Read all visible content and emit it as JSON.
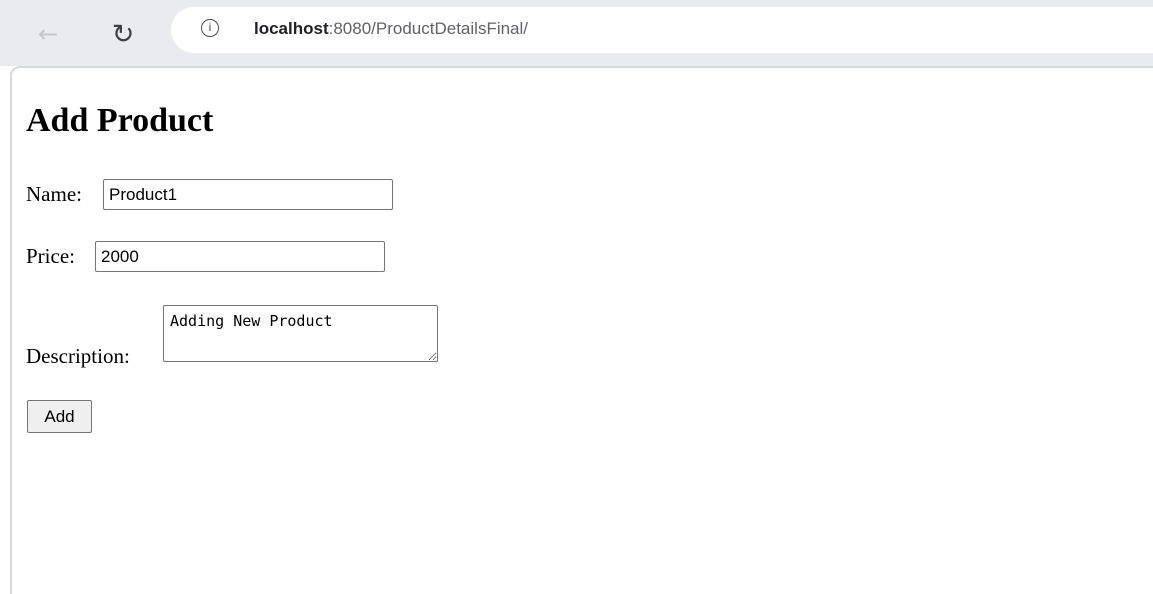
{
  "browser": {
    "url_host": "localhost",
    "url_path": ":8080/ProductDetailsFinal/"
  },
  "form": {
    "heading": "Add Product",
    "name_label": "Name:",
    "name_value": "Product1",
    "price_label": "Price:",
    "price_value": "2000",
    "description_label": "Description:",
    "description_value": "Adding New Product",
    "add_label": "Add"
  },
  "icons": {
    "back": "back-arrow-icon",
    "reload": "reload-icon",
    "info": "info-icon"
  },
  "colors": {
    "chrome_background": "#e9ebef",
    "omnibox_background": "#ffffff",
    "button_background": "#efefef"
  }
}
